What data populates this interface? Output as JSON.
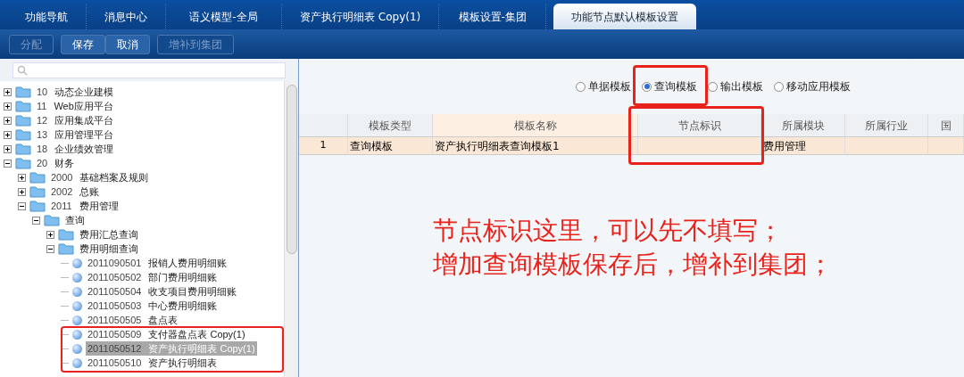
{
  "tabs": [
    {
      "label": "功能导航",
      "selected": false
    },
    {
      "label": "消息中心",
      "selected": false
    },
    {
      "label": "语义模型-全局",
      "selected": false
    },
    {
      "label": "资产执行明细表 Copy(1)",
      "selected": false
    },
    {
      "label": "模板设置-集团",
      "selected": false
    },
    {
      "label": "功能节点默认模板设置",
      "selected": true
    }
  ],
  "toolbar": [
    {
      "label": "分配",
      "disabled": true
    },
    {
      "label": "保存",
      "disabled": false
    },
    {
      "label": "取消",
      "disabled": false
    },
    {
      "label": "增补到集团",
      "disabled": true
    }
  ],
  "tree": [
    {
      "code": "10",
      "name": "动态企业建模",
      "expanded": false,
      "kind": "folder"
    },
    {
      "code": "11",
      "name": "Web应用平台",
      "expanded": false,
      "kind": "folder"
    },
    {
      "code": "12",
      "name": "应用集成平台",
      "expanded": false,
      "kind": "folder"
    },
    {
      "code": "13",
      "name": "应用管理平台",
      "expanded": false,
      "kind": "folder"
    },
    {
      "code": "18",
      "name": "企业绩效管理",
      "expanded": false,
      "kind": "folder"
    },
    {
      "code": "20",
      "name": "财务",
      "expanded": true,
      "kind": "folder",
      "children": [
        {
          "code": "2000",
          "name": "基础档案及规则",
          "expanded": false,
          "kind": "folder"
        },
        {
          "code": "2002",
          "name": "总账",
          "expanded": false,
          "kind": "folder"
        },
        {
          "code": "2011",
          "name": "费用管理",
          "expanded": true,
          "kind": "folder",
          "children": [
            {
              "name": "查询",
              "expanded": true,
              "kind": "folder",
              "children": [
                {
                  "name": "费用汇总查询",
                  "expanded": false,
                  "kind": "folder"
                },
                {
                  "name": "费用明细查询",
                  "expanded": true,
                  "kind": "folder",
                  "children": [
                    {
                      "code": "2011090501",
                      "name": "报销人费用明细账",
                      "kind": "leaf",
                      "selected": false
                    },
                    {
                      "code": "2011050502",
                      "name": "部门费用明细账",
                      "kind": "leaf",
                      "selected": false
                    },
                    {
                      "code": "2011050504",
                      "name": "收支项目费用明细账",
                      "kind": "leaf",
                      "selected": false
                    },
                    {
                      "code": "2011050503",
                      "name": "中心费用明细账",
                      "kind": "leaf",
                      "selected": false
                    },
                    {
                      "code": "2011050505",
                      "name": "盘点表",
                      "kind": "leaf",
                      "selected": false
                    },
                    {
                      "code": "2011050509",
                      "name": "支付器盘点表 Copy(1)",
                      "kind": "leaf",
                      "selected": false
                    },
                    {
                      "code": "2011050512",
                      "name": "资产执行明细表 Copy(1)",
                      "kind": "leaf",
                      "selected": true
                    },
                    {
                      "code": "2011050510",
                      "name": "资产执行明细表",
                      "kind": "leaf",
                      "selected": false
                    }
                  ]
                }
              ]
            }
          ]
        }
      ]
    }
  ],
  "radios": [
    {
      "label": "单据模板",
      "selected": false
    },
    {
      "label": "查询模板",
      "selected": true
    },
    {
      "label": "输出模板",
      "selected": false
    },
    {
      "label": "移动应用模板",
      "selected": false
    }
  ],
  "table": {
    "columns": [
      "模板类型",
      "模板名称",
      "节点标识",
      "所属模块",
      "所属行业",
      "国"
    ],
    "rows": [
      {
        "index": "1",
        "cells": [
          "查询模板",
          "资产执行明细表查询模板1",
          "",
          "费用管理",
          "",
          ""
        ]
      }
    ]
  },
  "annotations": [
    "节点标识这里，可以先不填写；",
    "增加查询模板保存后，增补到集团；"
  ]
}
